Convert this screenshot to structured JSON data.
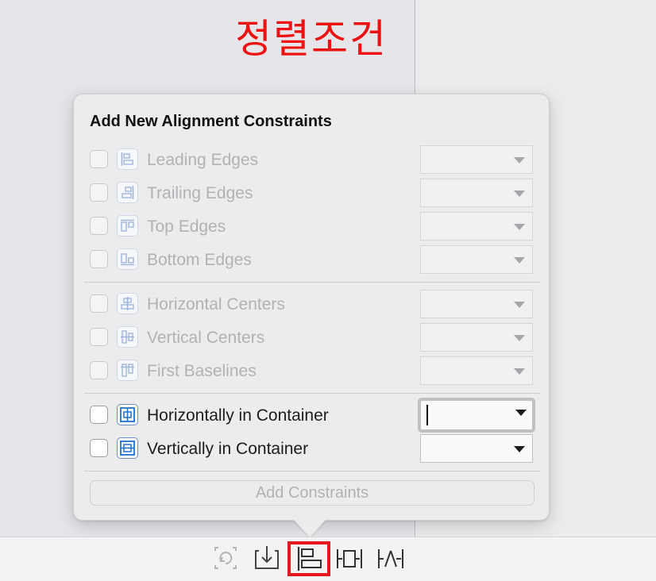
{
  "annotation": {
    "text": "정렬조건",
    "color": "#ee1111"
  },
  "popover": {
    "title": "Add New Alignment Constraints",
    "groups": [
      [
        {
          "label": "Leading Edges",
          "icon": "leading-edges-icon",
          "enabled": false,
          "checked": false
        },
        {
          "label": "Trailing Edges",
          "icon": "trailing-edges-icon",
          "enabled": false,
          "checked": false
        },
        {
          "label": "Top Edges",
          "icon": "top-edges-icon",
          "enabled": false,
          "checked": false
        },
        {
          "label": "Bottom Edges",
          "icon": "bottom-edges-icon",
          "enabled": false,
          "checked": false
        }
      ],
      [
        {
          "label": "Horizontal Centers",
          "icon": "horizontal-centers-icon",
          "enabled": false,
          "checked": false
        },
        {
          "label": "Vertical Centers",
          "icon": "vertical-centers-icon",
          "enabled": false,
          "checked": false
        },
        {
          "label": "First Baselines",
          "icon": "first-baselines-icon",
          "enabled": false,
          "checked": false
        }
      ],
      [
        {
          "label": "Horizontally in Container",
          "icon": "horizontally-in-container-icon",
          "enabled": true,
          "checked": false,
          "value": ""
        },
        {
          "label": "Vertically in Container",
          "icon": "vertically-in-container-icon",
          "enabled": true,
          "checked": false,
          "value": ""
        }
      ]
    ],
    "add_button_label": "Add Constraints"
  },
  "toolbar": {
    "icons": [
      "update-frames-icon",
      "embed-in-icon",
      "align-icon",
      "add-constraints-icon",
      "resolve-issues-icon"
    ],
    "active": "align-icon"
  },
  "colors": {
    "accent_focus": "#7aa6e8",
    "highlight_red": "#e8171f",
    "icon_blue": "#1f6fd1"
  }
}
